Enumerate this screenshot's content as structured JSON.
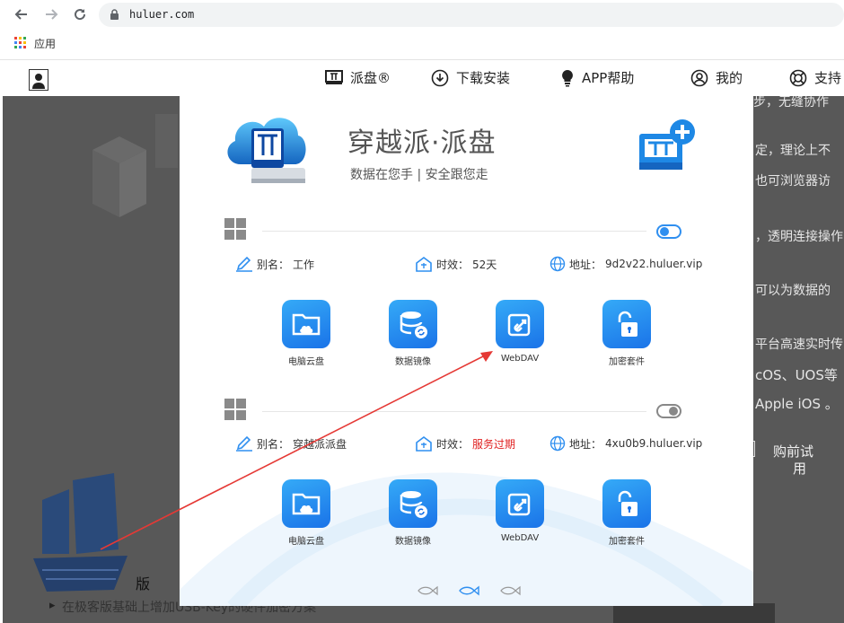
{
  "browser": {
    "url": "huluer.com",
    "bookmark_label": "应用"
  },
  "sitenav": {
    "items": [
      {
        "label": "派盘®",
        "icon": "pai-logo-icon"
      },
      {
        "label": "下载安装",
        "icon": "download-icon"
      },
      {
        "label": "APP帮助",
        "icon": "lightbulb-icon"
      },
      {
        "label": "我的",
        "icon": "user-icon"
      },
      {
        "label": "支持",
        "icon": "support-icon"
      }
    ]
  },
  "background": {
    "fragments": [
      "步，无缝协作",
      "定，理论上不",
      "也可浏览器访",
      "，透明连接操作",
      "可以为数据的",
      "平台高速实时传",
      "cOS、UOS等",
      "Apple iOS 。",
      "购前试",
      "用",
      "版",
      "在极客版基础上增加USB-Key的硬件加密方案"
    ]
  },
  "modal": {
    "title": "穿越派·派盘",
    "subtitle": "数据在您手 | 安全跟您走",
    "devices": [
      {
        "alias_label": "别名：",
        "alias": "工作",
        "validity_label": "时效：",
        "validity": "52天",
        "address_label": "地址：",
        "address": "9d2v22.huluer.vip",
        "enabled": true,
        "apps": [
          "电脑云盘",
          "数据镜像",
          "WebDAV",
          "加密套件"
        ]
      },
      {
        "alias_label": "别名：",
        "alias": "穿越派派盘",
        "validity_label": "时效：",
        "validity": "服务过期",
        "address_label": "地址：",
        "address": "4xu0b9.huluer.vip",
        "enabled": false,
        "apps": [
          "电脑云盘",
          "数据镜像",
          "WebDAV",
          "加密套件"
        ]
      }
    ]
  },
  "colors": {
    "accent": "#2f8ff0",
    "expired": "#e02020",
    "arrow": "#e53935",
    "overlay": "#585858"
  }
}
